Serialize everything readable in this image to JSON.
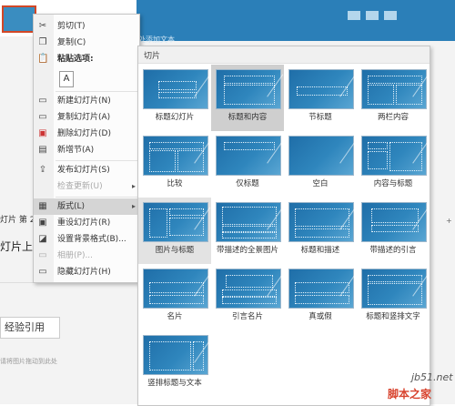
{
  "left": {
    "status": "灯片 第 2",
    "line2": "灯片上",
    "button": "经验引用",
    "hint": "请将图片拖动到此处"
  },
  "slide": {
    "placeholder": "处添加文本"
  },
  "context_menu": {
    "items": [
      {
        "label": "剪切(T)",
        "icon": "scissors-icon",
        "enabled": true
      },
      {
        "label": "复制(C)",
        "icon": "copy-icon",
        "enabled": true
      },
      {
        "label": "粘贴选项:",
        "icon": "paste-icon",
        "enabled": true
      },
      {
        "label": "新建幻灯片(N)",
        "icon": "new-slide-icon",
        "enabled": true
      },
      {
        "label": "复制幻灯片(A)",
        "icon": "duplicate-slide-icon",
        "enabled": true
      },
      {
        "label": "删除幻灯片(D)",
        "icon": "delete-slide-icon",
        "enabled": true
      },
      {
        "label": "新增节(A)",
        "icon": "add-section-icon",
        "enabled": true
      },
      {
        "label": "发布幻灯片(S)",
        "icon": "publish-icon",
        "enabled": true
      },
      {
        "label": "检查更新(U)",
        "icon": "check-update-icon",
        "enabled": false
      },
      {
        "label": "版式(L)",
        "icon": "layout-icon",
        "enabled": true
      },
      {
        "label": "重设幻灯片(R)",
        "icon": "reset-icon",
        "enabled": true
      },
      {
        "label": "设置背景格式(B)...",
        "icon": "background-icon",
        "enabled": true
      },
      {
        "label": "相册(P)...",
        "icon": "album-icon",
        "enabled": false
      },
      {
        "label": "隐藏幻灯片(H)",
        "icon": "hide-slide-icon",
        "enabled": true
      }
    ],
    "paste_glyph": "A"
  },
  "gallery": {
    "header": "切片",
    "layouts": [
      "标题幻灯片",
      "标题和内容",
      "节标题",
      "两栏内容",
      "比较",
      "仅标题",
      "空白",
      "内容与标题",
      "图片与标题",
      "带描述的全景图片",
      "标题和描述",
      "带描述的引言",
      "名片",
      "引言名片",
      "真或假",
      "标题和竖排文字",
      "竖排标题与文本"
    ],
    "selected": "标题和内容",
    "hovered": "图片与标题"
  },
  "watermark": {
    "site": "jb51.net",
    "name": "脚本之家"
  }
}
